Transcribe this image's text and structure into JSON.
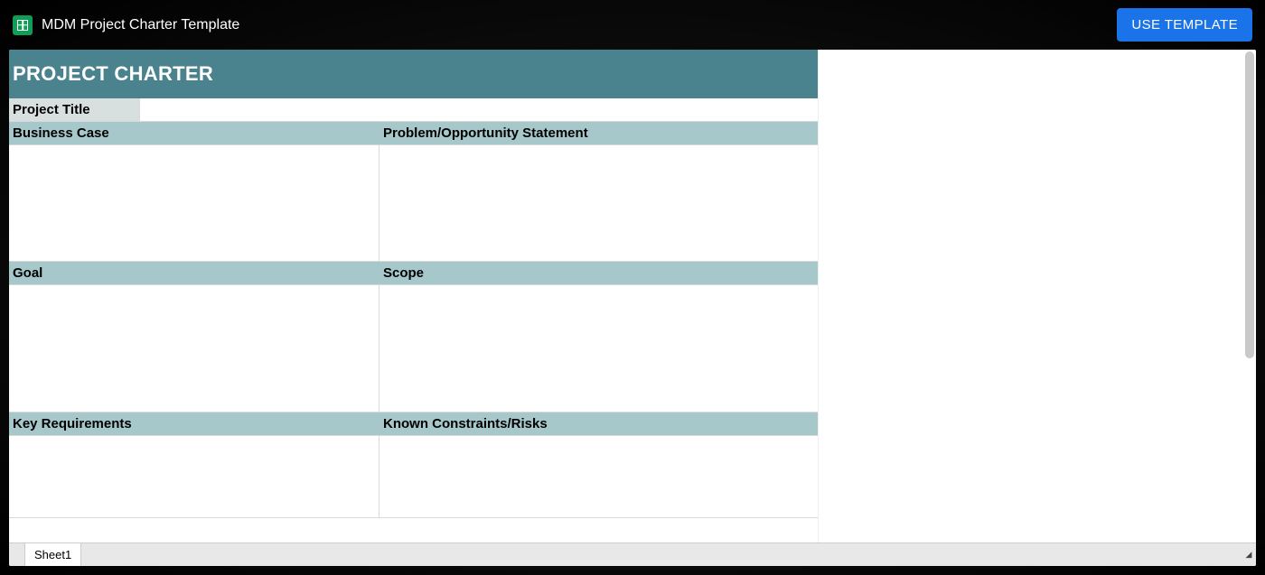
{
  "header": {
    "doc_title": "MDM Project Charter Template",
    "use_template_label": "USE TEMPLATE"
  },
  "sheet": {
    "title_banner": "PROJECT CHARTER",
    "project_title_label": "Project Title",
    "project_title_value": "",
    "sections": {
      "business_case_label": "Business Case",
      "problem_opportunity_label": "Problem/Opportunity Statement",
      "goal_label": "Goal",
      "scope_label": "Scope",
      "key_requirements_label": "Key Requirements",
      "known_constraints_label": "Known Constraints/Risks"
    },
    "tab_name": "Sheet1"
  },
  "colors": {
    "banner": "#4a838e",
    "section_header": "#a6c8ca",
    "project_title_bg": "#d8e0df",
    "primary_button": "#1a73e8"
  }
}
